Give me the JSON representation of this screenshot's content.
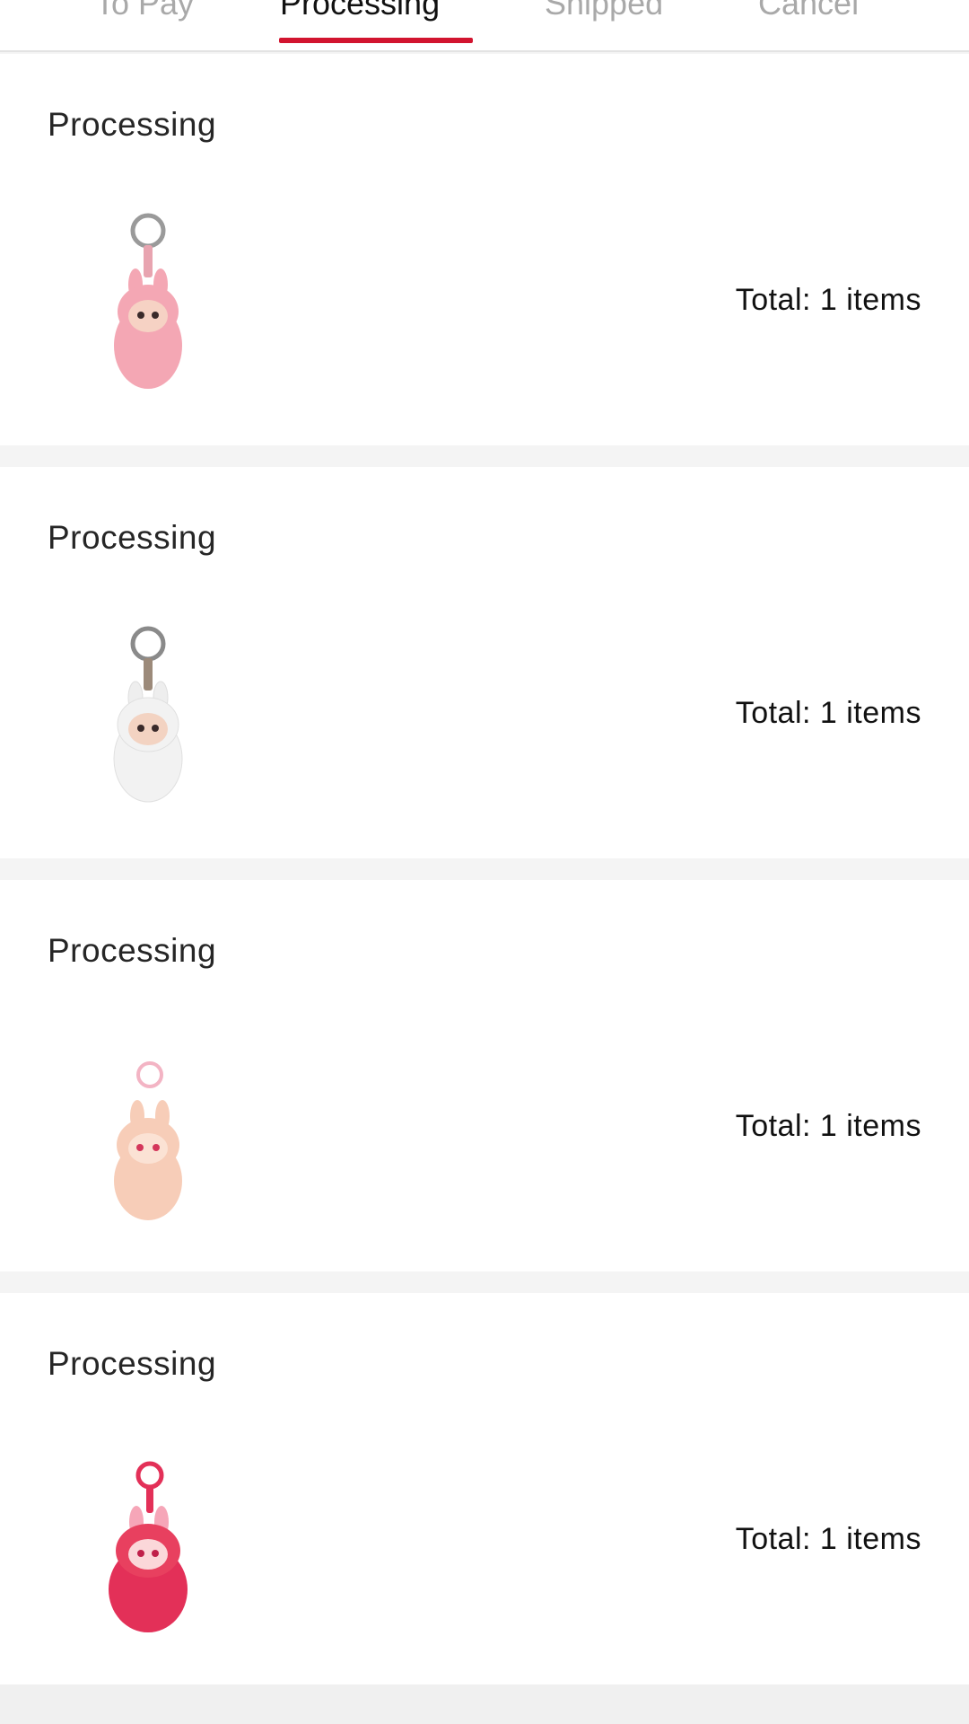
{
  "tabs": [
    {
      "label": "To Pay",
      "active": false
    },
    {
      "label": "Processing",
      "active": true
    },
    {
      "label": "Shipped",
      "active": false
    },
    {
      "label": "Cancel",
      "active": false
    }
  ],
  "accent_color": "#d2142f",
  "orders": [
    {
      "status": "Processing",
      "total": "Total: 1 items",
      "product_icon": "pink-bunny-keychain-icon",
      "color": "#f4a7b4",
      "ring": "#9a9a9a"
    },
    {
      "status": "Processing",
      "total": "Total: 1 items",
      "product_icon": "white-bunny-keychain-icon",
      "color": "#f2f2f2",
      "ring": "#8a8a8a"
    },
    {
      "status": "Processing",
      "total": "Total: 1 items",
      "product_icon": "peach-bunny-keychain-icon",
      "color": "#f7cdb8",
      "ring": "#f3b4c4"
    },
    {
      "status": "Processing",
      "total": "Total: 1 items",
      "product_icon": "red-bunny-keychain-icon",
      "color": "#e33058",
      "ring": "#e33058"
    }
  ]
}
